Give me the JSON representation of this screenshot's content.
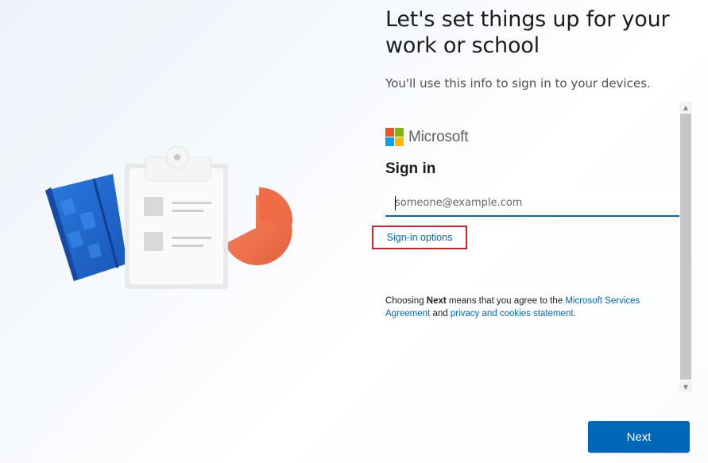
{
  "page": {
    "title": "Let's set things up for your work or school",
    "subtitle": "You'll use this info to sign in to your devices."
  },
  "signin": {
    "brand": "Microsoft",
    "heading": "Sign in",
    "email_placeholder": "someone@example.com",
    "email_value": "",
    "options_link": "Sign-in options",
    "agreement": {
      "prefix": "Choosing ",
      "bold": "Next",
      "middle": " means that you agree to the ",
      "link1": "Microsoft Services Agreement",
      "and": " and ",
      "link2": "privacy and cookies statement",
      "suffix": "."
    }
  },
  "buttons": {
    "next": "Next"
  },
  "colors": {
    "accent": "#0067b8",
    "highlight_box": "#d0202a",
    "ms_red": "#f25022",
    "ms_green": "#7fba00",
    "ms_blue": "#00a4ef",
    "ms_yellow": "#ffb900"
  },
  "icons": {
    "illustration": "clipboard-notebook-piechart-illustration",
    "logo": "microsoft-logo-icon"
  }
}
